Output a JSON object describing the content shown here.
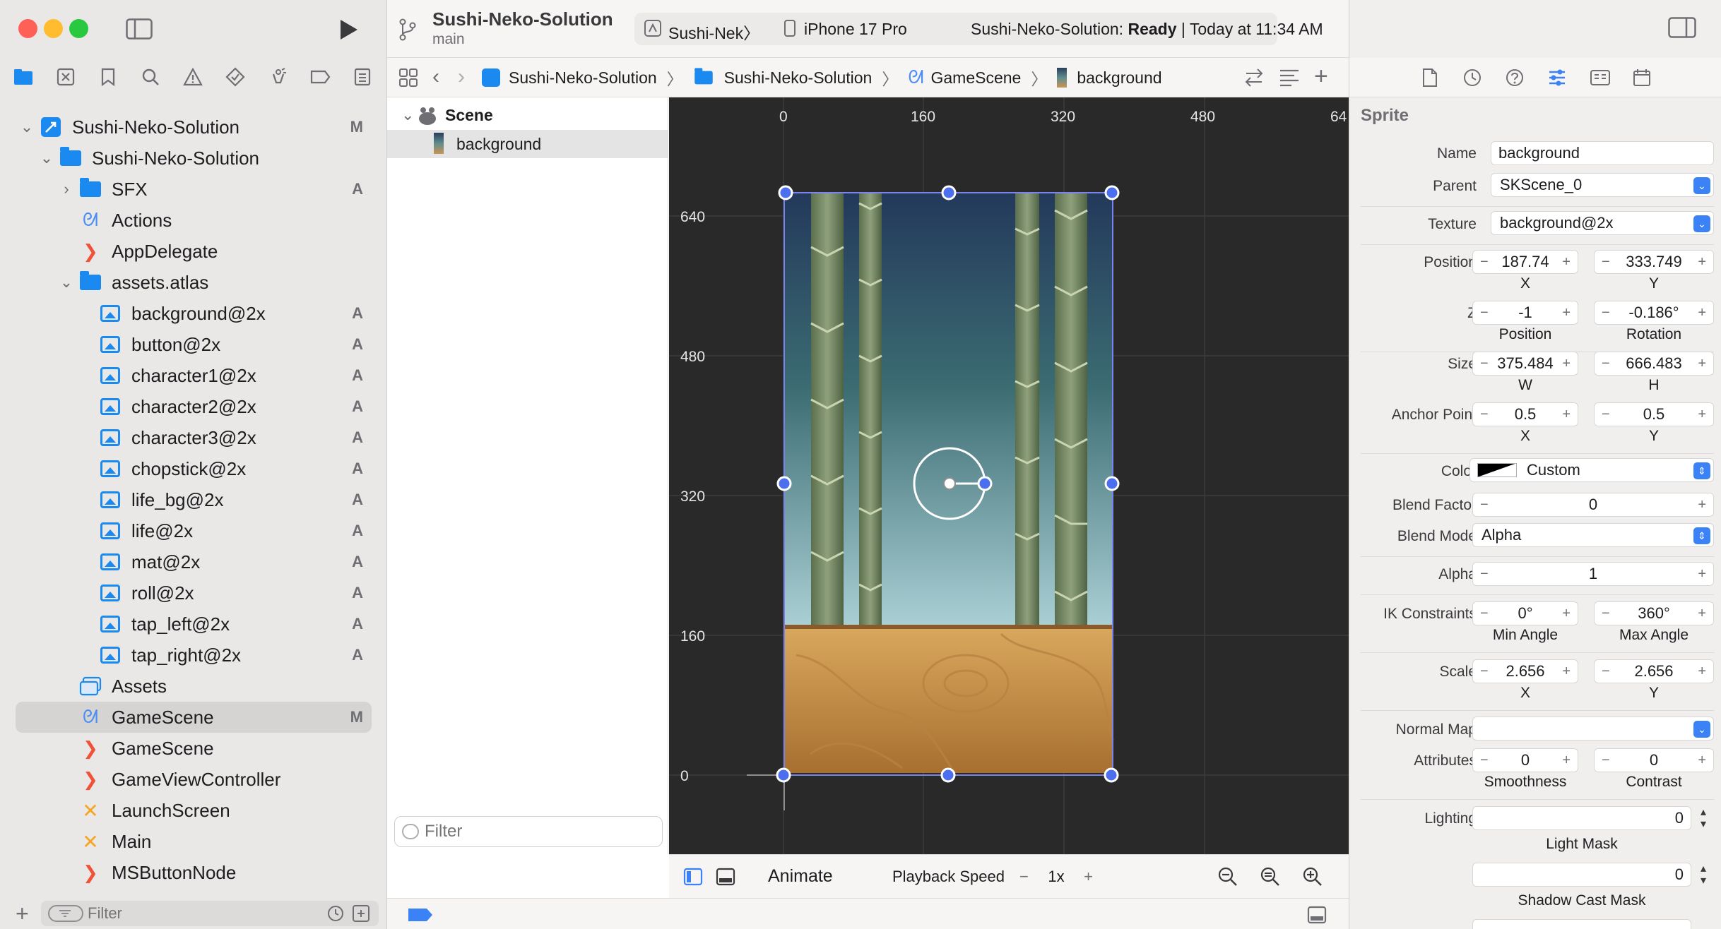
{
  "window": {
    "project_title": "Sushi-Neko-Solution",
    "branch": "main",
    "scheme": "Sushi-Nek〉",
    "device": "iPhone 17 Pro",
    "status_prefix": "Sushi-Neko-Solution:",
    "status_state": "Ready",
    "status_time": "| Today at 11:34 AM"
  },
  "navigator": {
    "items": [
      {
        "label": "Sushi-Neko-Solution",
        "badge": "M",
        "icon": "project-icon"
      },
      {
        "label": "Sushi-Neko-Solution",
        "badge": "",
        "icon": "folder-icon"
      },
      {
        "label": "SFX",
        "badge": "A",
        "icon": "folder-icon"
      },
      {
        "label": "Actions",
        "badge": "",
        "icon": "sks-icon"
      },
      {
        "label": "AppDelegate",
        "badge": "",
        "icon": "swift-icon"
      },
      {
        "label": "assets.atlas",
        "badge": "",
        "icon": "folder-icon"
      },
      {
        "label": "background@2x",
        "badge": "A",
        "icon": "image-icon"
      },
      {
        "label": "button@2x",
        "badge": "A",
        "icon": "image-icon"
      },
      {
        "label": "character1@2x",
        "badge": "A",
        "icon": "image-icon"
      },
      {
        "label": "character2@2x",
        "badge": "A",
        "icon": "image-icon"
      },
      {
        "label": "character3@2x",
        "badge": "A",
        "icon": "image-icon"
      },
      {
        "label": "chopstick@2x",
        "badge": "A",
        "icon": "image-icon"
      },
      {
        "label": "life_bg@2x",
        "badge": "A",
        "icon": "image-icon"
      },
      {
        "label": "life@2x",
        "badge": "A",
        "icon": "image-icon"
      },
      {
        "label": "mat@2x",
        "badge": "A",
        "icon": "image-icon"
      },
      {
        "label": "roll@2x",
        "badge": "A",
        "icon": "image-icon"
      },
      {
        "label": "tap_left@2x",
        "badge": "A",
        "icon": "image-icon"
      },
      {
        "label": "tap_right@2x",
        "badge": "A",
        "icon": "image-icon"
      },
      {
        "label": "Assets",
        "badge": "",
        "icon": "asset-catalog-icon"
      },
      {
        "label": "GameScene",
        "badge": "M",
        "icon": "sks-icon"
      },
      {
        "label": "GameScene",
        "badge": "",
        "icon": "swift-icon"
      },
      {
        "label": "GameViewController",
        "badge": "",
        "icon": "swift-icon"
      },
      {
        "label": "LaunchScreen",
        "badge": "",
        "icon": "xib-icon"
      },
      {
        "label": "Main",
        "badge": "",
        "icon": "xib-icon"
      },
      {
        "label": "MSButtonNode",
        "badge": "",
        "icon": "swift-icon"
      }
    ],
    "filter_placeholder": "Filter"
  },
  "jumpbar": {
    "crumbs": [
      "Sushi-Neko-Solution",
      "Sushi-Neko-Solution",
      "GameScene",
      "background"
    ]
  },
  "outline": {
    "root": "Scene",
    "child": "background",
    "filter_placeholder": "Filter"
  },
  "canvas": {
    "x_ticks": [
      "0",
      "160",
      "320",
      "480",
      "64"
    ],
    "y_ticks": [
      "640",
      "480",
      "320",
      "160",
      "0"
    ]
  },
  "canvas_bar": {
    "animate": "Animate",
    "playback_label": "Playback Speed",
    "playback_value": "1x",
    "minus": "−",
    "plus": "+"
  },
  "inspector": {
    "section": "Sprite",
    "name_label": "Name",
    "name_value": "background",
    "parent_label": "Parent",
    "parent_value": "SKScene_0",
    "texture_label": "Texture",
    "texture_value": "background@2x",
    "position_label": "Position",
    "position_x": "187.74",
    "position_y": "333.749",
    "x_label": "X",
    "y_label": "Y",
    "z_label": "Z",
    "z_position": "-1",
    "z_rotation": "-0.186°",
    "z_pos_sub": "Position",
    "z_rot_sub": "Rotation",
    "size_label": "Size",
    "size_w": "375.484",
    "size_h": "666.483",
    "w_label": "W",
    "h_label": "H",
    "anchor_label": "Anchor Point",
    "anchor_x": "0.5",
    "anchor_y": "0.5",
    "color_label": "Color",
    "color_value": "Custom",
    "blend_factor_label": "Blend Factor",
    "blend_factor_value": "0",
    "blend_mode_label": "Blend Mode",
    "blend_mode_value": "Alpha",
    "alpha_label": "Alpha",
    "alpha_value": "1",
    "ik_label": "IK Constraints",
    "ik_min": "0°",
    "ik_max": "360°",
    "ik_min_sub": "Min Angle",
    "ik_max_sub": "Max Angle",
    "scale_label": "Scale",
    "scale_x": "2.656",
    "scale_y": "2.656",
    "normal_map_label": "Normal Map",
    "attributes_label": "Attributes",
    "smoothness": "0",
    "contrast": "0",
    "smoothness_sub": "Smoothness",
    "contrast_sub": "Contrast",
    "lighting_label": "Lighting",
    "light_mask_value": "0",
    "light_mask_sub": "Light Mask",
    "shadow_cast_value": "0",
    "shadow_cast_sub": "Shadow Cast Mask"
  },
  "colors": {
    "accent": "#3b82f6",
    "canvas_bg": "#292929",
    "folder": "#1a8af0",
    "swift": "#f05138"
  }
}
